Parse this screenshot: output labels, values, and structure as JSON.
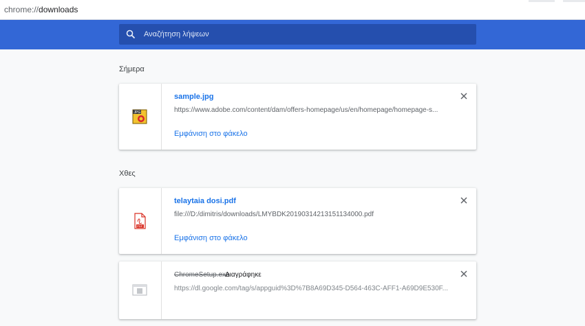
{
  "address_bar": {
    "scheme": "chrome://",
    "path": "downloads"
  },
  "search": {
    "placeholder": "Αναζήτηση λήψεων",
    "icon": "search-icon"
  },
  "colors": {
    "header": "#3367d6",
    "search_bg": "#254fae",
    "link": "#1a73e8",
    "page_bg": "#f8f9fa"
  },
  "sections": [
    {
      "title": "Σήμερα",
      "items": [
        {
          "file_name": "sample.jpg",
          "url": "https://www.adobe.com/content/dam/offers-homepage/us/en/homepage/homepage-s...",
          "action": "Εμφάνιση στο φάκελο",
          "icon": "jpg-file-icon"
        }
      ]
    },
    {
      "title": "Χθες",
      "items": [
        {
          "file_name": "telaytaia dosi.pdf",
          "url": "file:///D:/dimitris/downloads/LMYBDK20190314213151134000.pdf",
          "action": "Εμφάνιση στο φάκελο",
          "icon": "pdf-file-icon"
        },
        {
          "file_name": "ChromeSetup.exe",
          "status": "Διαγράφηκε",
          "url": "https://dl.google.com/tag/s/appguid%3D%7B8A69D345-D564-463C-AFF1-A69D9E530F...",
          "icon": "exe-file-icon"
        }
      ]
    }
  ]
}
